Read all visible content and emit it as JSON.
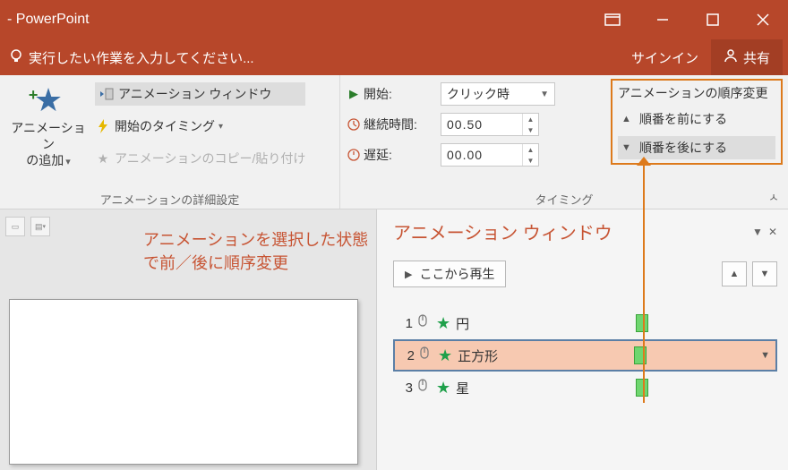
{
  "title_bar": {
    "app_name": "- PowerPoint"
  },
  "tellme": {
    "placeholder": "実行したい作業を入力してください...",
    "signin": "サインイン",
    "share": "共有"
  },
  "ribbon": {
    "advanced_group_label": "アニメーションの詳細設定",
    "timing_group_label": "タイミング",
    "add_animation": {
      "line1": "アニメーション",
      "line2": "の追加"
    },
    "anim_pane_btn": "アニメーション ウィンドウ",
    "trigger_btn": "開始のタイミング",
    "copy_btn": "アニメーションのコピー/貼り付け",
    "start_label": "開始:",
    "start_value": "クリック時",
    "duration_label": "継続時間:",
    "duration_value": "00.50",
    "delay_label": "遅延:",
    "delay_value": "00.00",
    "reorder_title": "アニメーションの順序変更",
    "move_earlier": "順番を前にする",
    "move_later": "順番を後にする"
  },
  "annotation": "アニメーションを選択した状態で前／後に順序変更",
  "pane": {
    "title": "アニメーション ウィンドウ",
    "play_from": "ここから再生",
    "items": [
      {
        "num": "1",
        "label": "円"
      },
      {
        "num": "2",
        "label": "正方形"
      },
      {
        "num": "3",
        "label": "星"
      }
    ]
  }
}
